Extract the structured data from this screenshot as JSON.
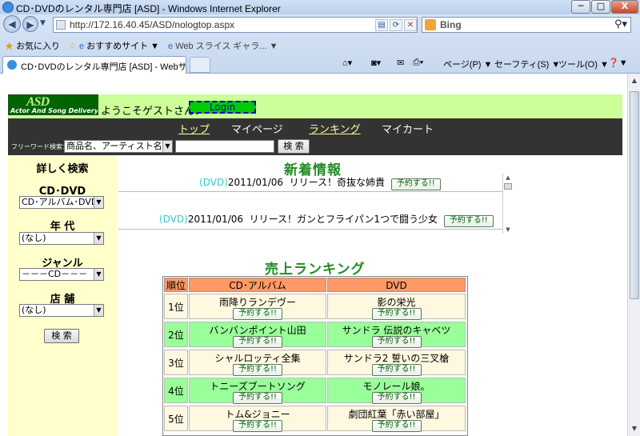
{
  "window": {
    "title": "CD･DVDのレンタル専門店 [ASD] - Windows Internet Explorer",
    "min_glyph": "─",
    "max_glyph": "□",
    "close_glyph": "X"
  },
  "address_bar": {
    "url": "http://172.16.40.45/ASD/nologtop.aspx",
    "search_engine": "Bing"
  },
  "favorites_bar": {
    "favorites": "お気に入り",
    "suggested": "おすすめサイト ▼",
    "slices": "Web スライス ギャラ... ▼"
  },
  "tab": {
    "title": "CD･DVDのレンタル専門店 [ASD] - Webサイト"
  },
  "command_bar": {
    "page": "ページ(P) ▼",
    "safety": "セーフティ(S) ▼",
    "tools": "ツール(O) ▼",
    "help": "❓▼"
  },
  "site": {
    "logo_mark": "ASD",
    "logo_sub": "Actor And Song Delivery",
    "welcome": "ようこそゲストさん！",
    "login_label": "Login",
    "nav": {
      "top": "トップ",
      "mypage": "マイページ",
      "ranking": "ランキング",
      "cart": "マイカート"
    },
    "search": {
      "label": "フリーワード検索：",
      "option": "商品名、アーティスト名から",
      "button": "検 索"
    }
  },
  "sidebar": {
    "title": "詳しく検索",
    "cd_dvd_label": "CD･DVD",
    "cd_dvd_value": "CD･アルバム･DVD",
    "era_label": "年 代",
    "era_value": "(なし)",
    "genre_label": "ジャンル",
    "genre_value": "－－－CD－－－",
    "store_label": "店 舗",
    "store_value": "(なし)",
    "search_button": "検 索"
  },
  "news": {
    "title": "新着情報",
    "items": [
      {
        "category": "(DVD)",
        "date": "2011/01/06",
        "text": "リリース！奇抜な姉貴",
        "button": "予約する!!"
      },
      {
        "category": "(DVD)",
        "date": "2011/01/06",
        "text": "リリース！ガンとフライパン1つで闘う少女",
        "button": "予約する!!"
      }
    ]
  },
  "ranking": {
    "title": "売上ランキング",
    "headers": {
      "rank": "順位",
      "cd": "CD･アルバム",
      "dvd": "DVD"
    },
    "reserve_label": "予約する!!",
    "rows": [
      {
        "rank": "1位",
        "cd": "雨降りランデヴー",
        "dvd": "影の栄光"
      },
      {
        "rank": "2位",
        "cd": "バンバンポイント山田",
        "dvd": "サンドラ 伝説のキャベツ"
      },
      {
        "rank": "3位",
        "cd": "シャルロッティ全集",
        "dvd": "サンドラ2 誓いの三叉槍"
      },
      {
        "rank": "4位",
        "cd": "トニーズブートソング",
        "dvd": "モノレール娘。"
      },
      {
        "rank": "5位",
        "cd": "トム&ジョニー",
        "dvd": "劇団紅葉「赤い部屋」"
      }
    ]
  },
  "colors": {
    "header_band": "#ccff99",
    "nav_bg": "#333333",
    "sidebar_bg": "#ffffcc",
    "section_title": "#228b22",
    "rank_header": "#ff9966",
    "row_light": "#fff8e0",
    "row_green": "#99ff99"
  }
}
